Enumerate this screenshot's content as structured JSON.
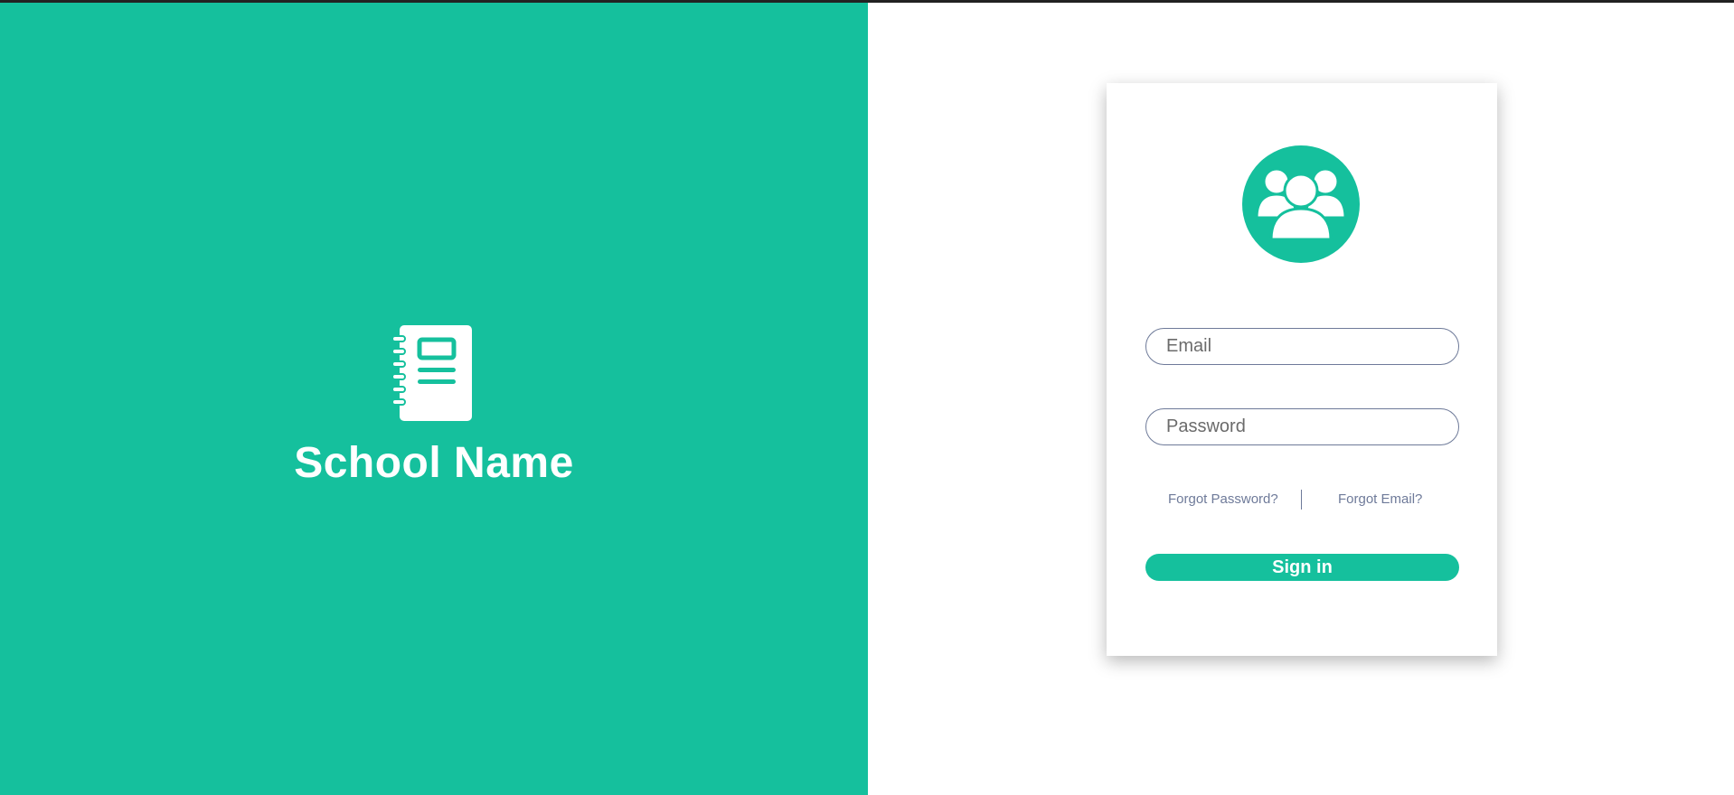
{
  "brand": {
    "icon": "notebook-icon",
    "school_name": "School Name"
  },
  "login": {
    "avatar_icon": "users-group-icon",
    "email": {
      "value": "",
      "placeholder": "Email"
    },
    "password": {
      "value": "",
      "placeholder": "Password"
    },
    "forgot_password_label": "Forgot Password?",
    "forgot_email_label": "Forgot Email?",
    "sign_in_label": "Sign in"
  },
  "colors": {
    "accent": "#15c09d",
    "field_border": "#6e7a99",
    "link": "#6e7a99",
    "background": "#ffffff"
  }
}
